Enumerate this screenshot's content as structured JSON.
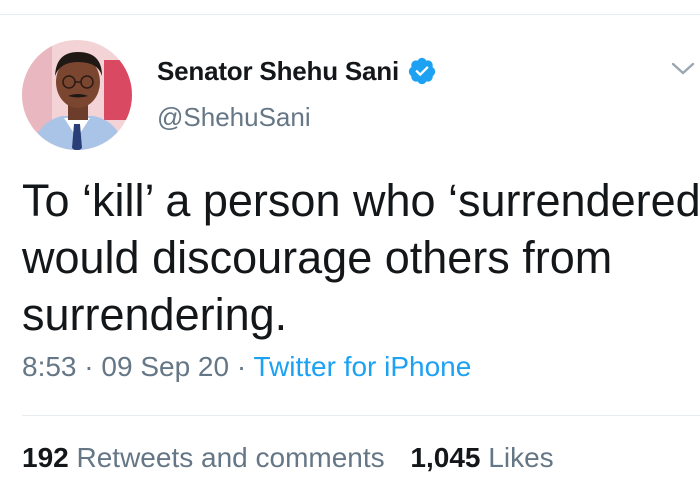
{
  "tweet": {
    "author": {
      "display_name": "Senator Shehu Sani",
      "handle": "@ShehuSani",
      "verified": true,
      "avatar_icon": "profile-photo"
    },
    "text_lines": [
      "To ‘kill’ a person who ‘surrendered’",
      "would discourage others from",
      "surrendering."
    ],
    "meta": {
      "time": "8:53",
      "separator": " · ",
      "date": "09 Sep 20",
      "source": "Twitter for iPhone"
    },
    "stats": {
      "retweets_count": "192",
      "retweets_label": "Retweets and comments",
      "likes_count": "1,045",
      "likes_label": "Likes"
    },
    "menu_icon": "chevron-down-icon"
  },
  "colors": {
    "accent": "#1da1f2",
    "text_primary": "#14171a",
    "text_secondary": "#657786",
    "divider": "#e6ecf0"
  }
}
